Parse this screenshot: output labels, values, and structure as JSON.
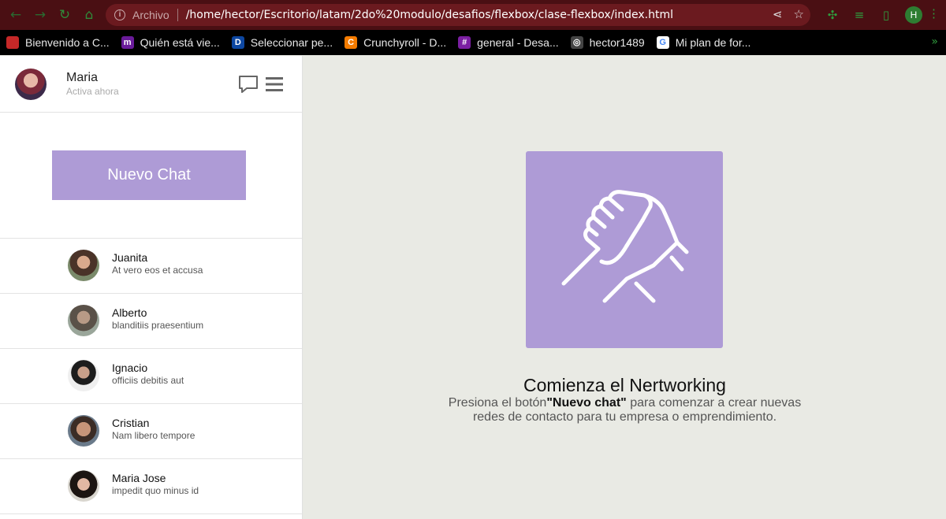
{
  "browser": {
    "address_prefix": "Archivo",
    "url": "/home/hector/Escritorio/latam/2do%20modulo/desafios/flexbox/clase-flexbox/index.html",
    "profile_initial": "H",
    "bookmarks": [
      {
        "label": "Bienvenido a C...",
        "icon_color": "#c62828"
      },
      {
        "label": "Quién está vie...",
        "icon_color": "#6a1b9a",
        "glyph": "m"
      },
      {
        "label": "Seleccionar pe...",
        "icon_color": "#0d47a1",
        "glyph": "D"
      },
      {
        "label": "Crunchyroll - D...",
        "icon_color": "#f57c00",
        "glyph": "C"
      },
      {
        "label": "general - Desa...",
        "icon_color": "#7b1fa2",
        "glyph": "#"
      },
      {
        "label": "hector1489",
        "icon_color": "#444444",
        "glyph": "◎"
      },
      {
        "label": "Mi plan de for...",
        "icon_color": "#ffffff",
        "glyph": "G"
      }
    ]
  },
  "user": {
    "name": "Maria",
    "status": "Activa ahora"
  },
  "sidebar": {
    "new_chat_label": "Nuevo Chat",
    "contacts": [
      {
        "name": "Juanita",
        "message": "At vero eos et accusa"
      },
      {
        "name": "Alberto",
        "message": "blanditiis praesentium"
      },
      {
        "name": "Ignacio",
        "message": "officiis debitis aut"
      },
      {
        "name": "Cristian",
        "message": "Nam libero tempore"
      },
      {
        "name": "Maria Jose",
        "message": "impedit quo minus id"
      }
    ]
  },
  "main": {
    "headline": "Comienza el Nertworking",
    "sub_before": "Presiona el botón",
    "sub_bold": "\"Nuevo chat\"",
    "sub_after": " para comenzar a crear nuevas redes de contacto para tu empresa o emprendimiento.",
    "hero_icon": "handshake-icon",
    "accent": "#ae9bd6"
  }
}
